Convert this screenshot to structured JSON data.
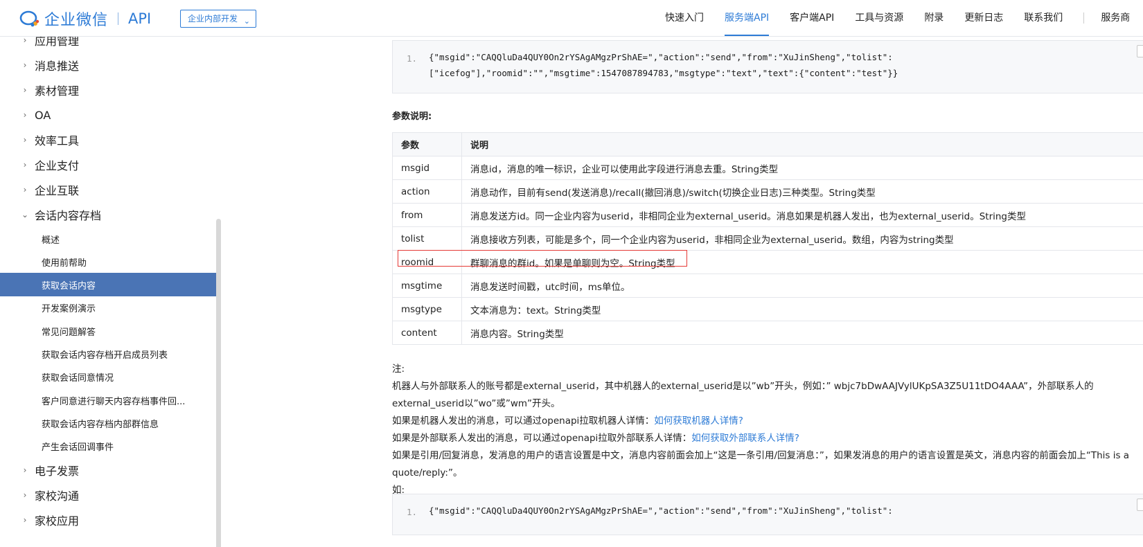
{
  "header": {
    "logo_text": "企业微信",
    "logo_api": "API",
    "dev_select": "企业内部开发",
    "nav": [
      "快速入门",
      "服务端API",
      "客户端API",
      "工具与资源",
      "附录",
      "更新日志",
      "联系我们",
      "服务商"
    ]
  },
  "sidebar": {
    "items": [
      "应用管理",
      "消息推送",
      "素材管理",
      "OA",
      "效率工具",
      "企业支付",
      "企业互联",
      "会话内容存档"
    ],
    "sub_items": [
      "概述",
      "使用前帮助",
      "获取会话内容",
      "开发案例演示",
      "常见问题解答",
      "获取会话内容存档开启成员列表",
      "获取会话同意情况",
      "客户同意进行聊天内容存档事件回...",
      "获取会话内容存档内部群信息",
      "产生会话回调事件"
    ],
    "items_after": [
      "电子发票",
      "家校沟通",
      "家校应用"
    ]
  },
  "code_top": {
    "line_no": "1.",
    "line1": "{\"msgid\":\"CAQQluDa4QUY0On2rYSAgAMgzPrShAE=\",\"action\":\"send\",\"from\":\"XuJinSheng\",\"tolist\":",
    "line2": "[\"icefog\"],\"roomid\":\"\",\"msgtime\":1547087894783,\"msgtype\":\"text\",\"text\":{\"content\":\"test\"}}"
  },
  "params_title": "参数说明:",
  "table": {
    "headers": [
      "参数",
      "说明"
    ],
    "rows": [
      [
        "msgid",
        "消息id，消息的唯一标识，企业可以使用此字段进行消息去重。String类型"
      ],
      [
        "action",
        "消息动作，目前有send(发送消息)/recall(撤回消息)/switch(切换企业日志)三种类型。String类型"
      ],
      [
        "from",
        "消息发送方id。同一企业内容为userid，非相同企业为external_userid。消息如果是机器人发出，也为external_userid。String类型"
      ],
      [
        "tolist",
        "消息接收方列表，可能是多个，同一个企业内容为userid，非相同企业为external_userid。数组，内容为string类型"
      ],
      [
        "roomid",
        "群聊消息的群id。如果是单聊则为空。String类型"
      ],
      [
        "msgtime",
        "消息发送时间戳，utc时间，ms单位。"
      ],
      [
        "msgtype",
        "文本消息为：text。String类型"
      ],
      [
        "content",
        "消息内容。String类型"
      ]
    ]
  },
  "notes": {
    "label": "注:",
    "p1": "机器人与外部联系人的账号都是external_userid，其中机器人的external_userid是以”wb”开头，例如：” wbjc7bDwAAJVylUKpSA3Z5U11tDO4AAA”，外部联系人的external_userid以”wo”或”wm”开头。",
    "p2_text": "如果是机器人发出的消息，可以通过openapi拉取机器人详情：",
    "p2_link": "如何获取机器人详情?",
    "p3_text": "如果是外部联系人发出的消息，可以通过openapi拉取外部联系人详情：",
    "p3_link": "如何获取外部联系人详情?",
    "p4": "如果是引用/回复消息，发消息的用户的语言设置是中文，消息内容前面会加上“这是一条引用/回复消息：”，如果发消息的用户的语言设置是英文，消息内容的前面会加上“This is a quote/reply:”。",
    "p5": "如:"
  },
  "code_bottom": {
    "line_no": "1.",
    "line1": "{\"msgid\":\"CAQQluDa4QUY0On2rYSAgAMgzPrShAE=\",\"action\":\"send\",\"from\":\"XuJinSheng\",\"tolist\":"
  },
  "colors": {
    "brand": "#2d7bd6",
    "sidebar_active": "#4a74b5",
    "highlight_box": "#e53935"
  }
}
